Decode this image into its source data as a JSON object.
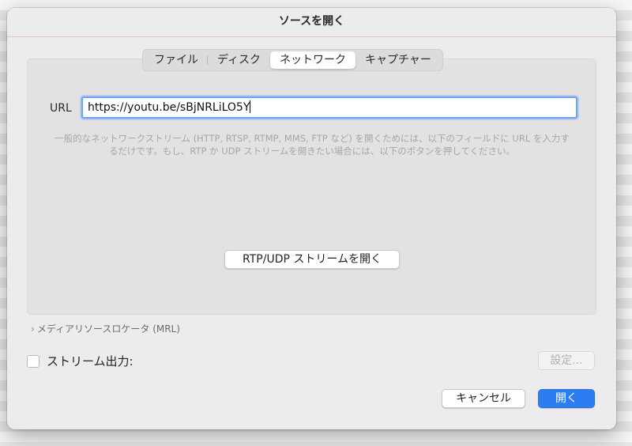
{
  "window": {
    "title": "ソースを開く"
  },
  "tabs": [
    {
      "label": "ファイル",
      "active": false
    },
    {
      "label": "ディスク",
      "active": false
    },
    {
      "label": "ネットワーク",
      "active": true
    },
    {
      "label": "キャプチャー",
      "active": false
    }
  ],
  "url": {
    "label": "URL",
    "value": "https://youtu.be/sBjNRLiLO5Y"
  },
  "help_text": "一般的なネットワークストリーム (HTTP, RTSP, RTMP, MMS, FTP など) を開くためには、以下のフィールドに URL を入力するだけです。もし、RTP か UDP ストリームを開きたい場合には、以下のボタンを押してください。",
  "rtp_button": {
    "label": "RTP/UDP ストリームを開く"
  },
  "mrl": {
    "chevron": "›",
    "label": "メディアリソースロケータ (MRL)"
  },
  "stream_output": {
    "label": "ストリーム出力:",
    "checked": false
  },
  "settings_button": {
    "label": "設定...",
    "enabled": false
  },
  "cancel_button": {
    "label": "キャンセル"
  },
  "open_button": {
    "label": "開く"
  },
  "colors": {
    "accent": "#2c7df2",
    "focus_ring": "#6ea3f0",
    "dialog_bg": "#ececec",
    "panel_bg": "#e2e2e2"
  }
}
